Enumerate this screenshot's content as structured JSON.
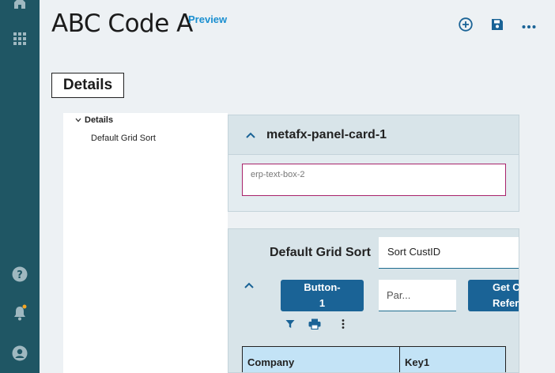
{
  "header": {
    "title": "ABC Code A",
    "badge": "Preview",
    "actions": [
      {
        "name": "add-circle-icon"
      },
      {
        "name": "save-icon"
      },
      {
        "name": "more-horizontal-icon"
      }
    ]
  },
  "rail": {
    "icons": [
      "home-icon",
      "apps-grid-icon",
      "help-icon",
      "notifications-icon",
      "user-account-icon"
    ],
    "notification_dot_color": "#f5a623"
  },
  "tab": {
    "label": "Details"
  },
  "tree": {
    "root": "Details",
    "children": [
      "Default Grid Sort"
    ]
  },
  "card1": {
    "title": "metafx-panel-card-1",
    "textbox_placeholder": "erp-text-box-2"
  },
  "card2": {
    "title": "Default Grid Sort",
    "sort_value": "Sort CustID",
    "button1_label_line1": "Button-",
    "button1_label_line2": "1",
    "param_value": "Par...",
    "button2_label_line1": "Get Cr",
    "button2_label_line2": "Refere",
    "tools": [
      "filter-icon",
      "print-icon",
      "more-vertical-icon"
    ],
    "grid_columns": [
      "Company",
      "Key1"
    ]
  },
  "colors": {
    "rail": "#1f5664",
    "accent": "#1a6396",
    "preview": "#1a8fd0",
    "grid_header": "#c3e3f6",
    "textbox_border": "#a8236b"
  }
}
